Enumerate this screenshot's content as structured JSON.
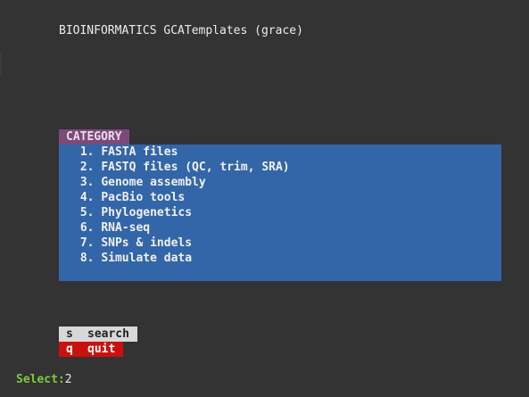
{
  "header": {
    "title": "BIOINFORMATICS GCATemplates (grace)"
  },
  "colors": {
    "background": "#333333",
    "category_tab": "#7c4a7a",
    "menu_panel": "#3366a8",
    "search_key_bg": "#d8d8d8",
    "quit_key_bg": "#cc1010",
    "prompt_label": "#7ec93d"
  },
  "category": {
    "label": "CATEGORY",
    "items": [
      {
        "number": "1.",
        "label": "FASTA files"
      },
      {
        "number": "2.",
        "label": "FASTQ files (QC, trim, SRA)"
      },
      {
        "number": "3.",
        "label": "Genome assembly"
      },
      {
        "number": "4.",
        "label": "PacBio tools"
      },
      {
        "number": "5.",
        "label": "Phylogenetics"
      },
      {
        "number": "6.",
        "label": "RNA-seq"
      },
      {
        "number": "7.",
        "label": "SNPs & indels"
      },
      {
        "number": "8.",
        "label": "Simulate data"
      }
    ]
  },
  "keys": {
    "search": {
      "key": "s",
      "label": "search"
    },
    "quit": {
      "key": "q",
      "label": "quit"
    }
  },
  "prompt": {
    "label": "Select:",
    "value": "2"
  }
}
